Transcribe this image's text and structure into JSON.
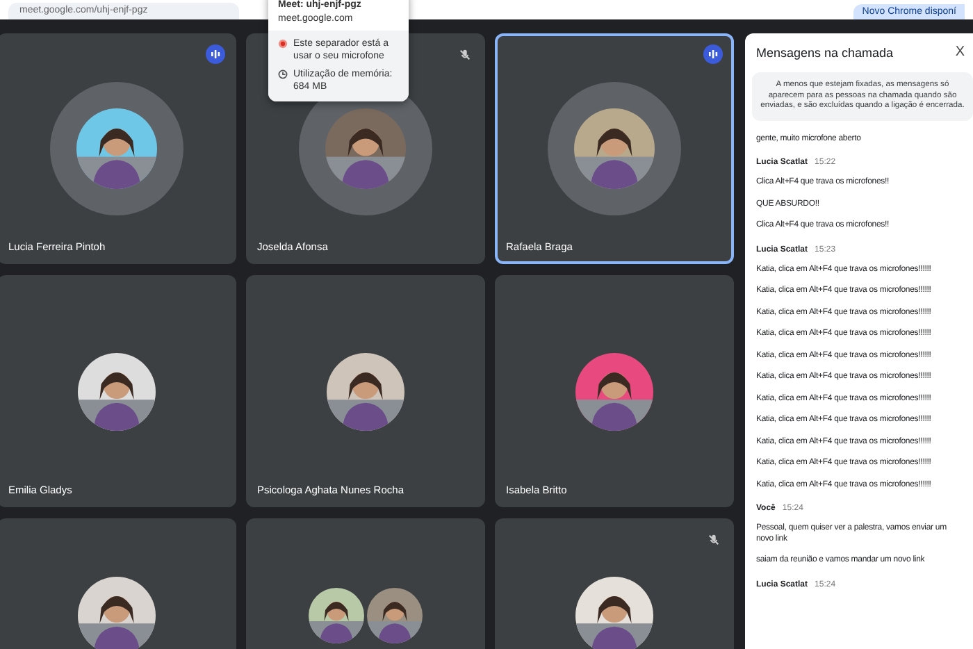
{
  "browser": {
    "url": "meet.google.com/uhj-enjf-pgz",
    "update_button": "Novo Chrome disponí"
  },
  "tab_tooltip": {
    "title": "Meet: uhj-enjf-pgz",
    "host": "meet.google.com",
    "mic_notice": "Este separador está a usar o seu microfone",
    "memory": "Utilização de memória: 684 MB"
  },
  "tiles": [
    {
      "name": "Lucia Ferreira Pintoh",
      "speaking": true,
      "muted": false,
      "selected": false
    },
    {
      "name": "Joselda Afonsa",
      "speaking": false,
      "muted": true,
      "selected": false
    },
    {
      "name": "Rafaela Braga",
      "speaking": true,
      "muted": false,
      "selected": true
    },
    {
      "name": "Emilia Gladys",
      "speaking": false,
      "muted": false,
      "selected": false
    },
    {
      "name": "Psicologa Aghata Nunes Rocha",
      "speaking": false,
      "muted": false,
      "selected": false
    },
    {
      "name": "Isabela Britto",
      "speaking": false,
      "muted": false,
      "selected": false
    },
    {
      "speaking": false,
      "muted": false,
      "selected": false
    },
    {
      "speaking": false,
      "muted": false,
      "selected": false
    },
    {
      "speaking": false,
      "muted": true,
      "selected": false
    }
  ],
  "chat": {
    "title": "Mensagens na chamada",
    "close": "X",
    "notice": "A menos que estejam fixadas, as mensagens só aparecem para as pessoas na chamada quando são enviadas, e são excluídas quando a ligação é encerrada.",
    "groups": [
      {
        "messages": [
          "gente, muito microfone aberto"
        ]
      },
      {
        "sender": "Lucia Scatlat",
        "time": "15:22",
        "messages": [
          "Clica Alt+F4 que trava os microfones!!",
          "QUE ABSURDO!!",
          "Clica Alt+F4 que trava os microfones!!"
        ]
      },
      {
        "sender": "Lucia Scatlat",
        "time": "15:23",
        "messages": [
          "Katia, clica em Alt+F4 que trava os microfones!!!!!!",
          "Katia, clica em Alt+F4 que trava os microfones!!!!!!",
          "Katia, clica em Alt+F4 que trava os microfones!!!!!!",
          "Katia, clica em Alt+F4 que trava os microfones!!!!!!",
          "Katia, clica em Alt+F4 que trava os microfones!!!!!!",
          "Katia, clica em Alt+F4 que trava os microfones!!!!!!",
          "Katia, clica em Alt+F4 que trava os microfones!!!!!!",
          "Katia, clica em Alt+F4 que trava os microfones!!!!!!",
          "Katia, clica em Alt+F4 que trava os microfones!!!!!!",
          "Katia, clica em Alt+F4 que trava os microfones!!!!!!",
          "Katia, clica em Alt+F4 que trava os microfones!!!!!!"
        ]
      },
      {
        "sender": "Você",
        "time": "15:24",
        "messages": [
          "Pessoal, quem quiser ver a palestra, vamos enviar um novo link",
          "saiam da reunião e vamos mandar um novo link"
        ]
      },
      {
        "sender": "Lucia Scatlat",
        "time": "15:24"
      }
    ]
  }
}
